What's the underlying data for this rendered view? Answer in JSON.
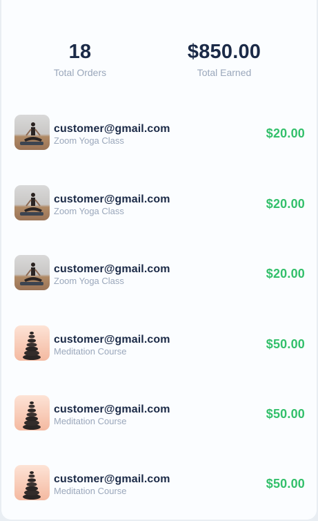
{
  "summary": {
    "total_orders_value": "18",
    "total_orders_label": "Total Orders",
    "total_earned_value": "$850.00",
    "total_earned_label": "Total Earned"
  },
  "colors": {
    "text_primary": "#1b2a47",
    "text_muted": "#9aa7bb",
    "amount_green": "#33c06b"
  },
  "orders": [
    {
      "thumbnail_icon": "yoga-thumbnail",
      "email": "customer@gmail.com",
      "product": "Zoom Yoga Class",
      "amount": "$20.00"
    },
    {
      "thumbnail_icon": "yoga-thumbnail",
      "email": "customer@gmail.com",
      "product": "Zoom Yoga Class",
      "amount": "$20.00"
    },
    {
      "thumbnail_icon": "yoga-thumbnail",
      "email": "customer@gmail.com",
      "product": "Zoom Yoga Class",
      "amount": "$20.00"
    },
    {
      "thumbnail_icon": "stones-thumbnail",
      "email": "customer@gmail.com",
      "product": "Meditation Course",
      "amount": "$50.00"
    },
    {
      "thumbnail_icon": "stones-thumbnail",
      "email": "customer@gmail.com",
      "product": "Meditation Course",
      "amount": "$50.00"
    },
    {
      "thumbnail_icon": "stones-thumbnail",
      "email": "customer@gmail.com",
      "product": "Meditation Course",
      "amount": "$50.00"
    }
  ]
}
